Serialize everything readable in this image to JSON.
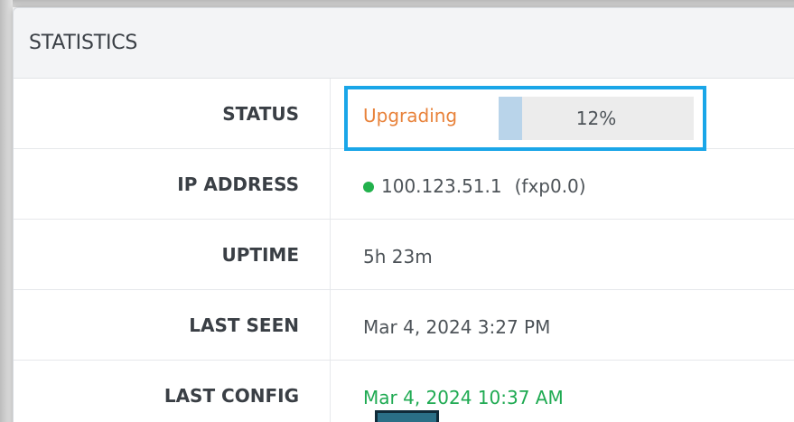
{
  "panel": {
    "title": "STATISTICS"
  },
  "rows": [
    {
      "label": "STATUS"
    },
    {
      "label": "IP ADDRESS"
    },
    {
      "label": "UPTIME"
    },
    {
      "label": "LAST SEEN"
    },
    {
      "label": "LAST CONFIG"
    }
  ],
  "status": {
    "text": "Upgrading",
    "progress_label": "12%",
    "progress_fraction": 0.12
  },
  "ip": {
    "address": "100.123.51.1",
    "interface": "(fxp0.0)",
    "indicator_color": "#22b14c"
  },
  "uptime": "5h 23m",
  "last_seen": "Mar 4, 2024 3:27 PM",
  "last_config": "Mar 4, 2024 10:37 AM",
  "colors": {
    "status_text": "#e8823a",
    "highlight_border": "#1aa6e8",
    "progress_fill": "#b9d4ea",
    "config_text": "#1faa52"
  }
}
